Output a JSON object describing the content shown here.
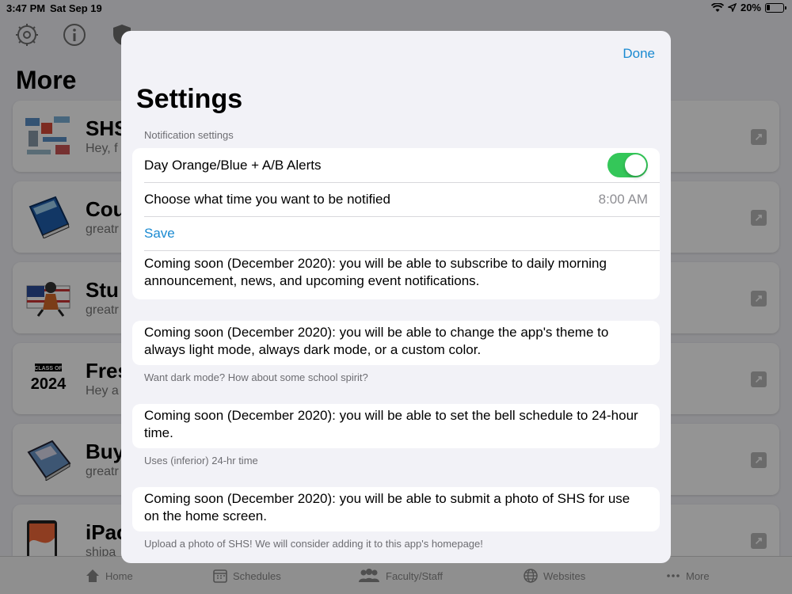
{
  "status_bar": {
    "time": "3:47 PM",
    "date": "Sat Sep 19",
    "battery": "20%"
  },
  "background": {
    "title": "More",
    "items": [
      {
        "title": "SHS",
        "subtitle": "Hey, f"
      },
      {
        "title": "Cou",
        "subtitle": "greatr"
      },
      {
        "title": "Stu",
        "subtitle": "greatr"
      },
      {
        "title": "Fres",
        "subtitle": "Hey a"
      },
      {
        "title": "Buy",
        "subtitle": "greatr"
      },
      {
        "title": "iPac",
        "subtitle": "shipa"
      }
    ],
    "class_badge_top": "CLASS OF",
    "class_badge_year": "2024",
    "tabs": [
      {
        "label": "Home",
        "icon": "house-icon"
      },
      {
        "label": "Schedules",
        "icon": "calendar-icon"
      },
      {
        "label": "Faculty/Staff",
        "icon": "people-icon"
      },
      {
        "label": "Websites",
        "icon": "globe-icon"
      },
      {
        "label": "More",
        "icon": "ellipsis-icon"
      }
    ]
  },
  "settings": {
    "done_label": "Done",
    "title": "Settings",
    "notification_header": "Notification settings",
    "alerts_label": "Day Orange/Blue + A/B Alerts",
    "alerts_on": true,
    "time_label": "Choose what time you want to be notified",
    "time_value": "8:00 AM",
    "save_label": "Save",
    "notification_note": "Coming soon (December 2020): you will be able to subscribe to daily morning announcement, news, and upcoming event notifications.",
    "theme_note": "Coming soon (December 2020): you will be able to change the app's theme to always light mode, always dark mode, or a custom color.",
    "theme_footer": "Want dark mode?  How about some school spirit?",
    "bell_note": "Coming soon (December 2020): you will be able to set the bell schedule to 24-hour time.",
    "bell_footer": "Uses (inferior) 24-hr time",
    "photo_note": "Coming soon (December 2020): you will be able to submit a photo of SHS for use on the home screen.",
    "photo_footer": "Upload a photo of SHS!  We will consider adding it to this app's homepage!"
  },
  "colors": {
    "accent": "#1a8ad1",
    "toggle_on": "#34c759"
  }
}
